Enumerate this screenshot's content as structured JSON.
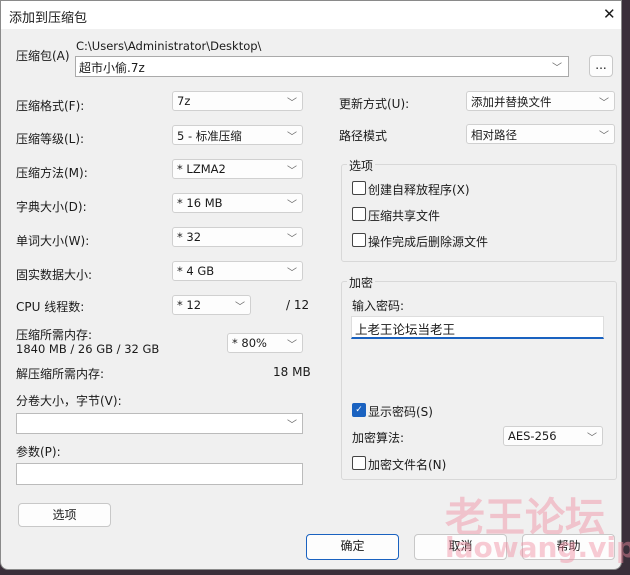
{
  "title": "添加到压缩包",
  "archive": {
    "label": "压缩包(A)",
    "path": "C:\\Users\\Administrator\\Desktop\\",
    "name": "超市小偷.7z",
    "browse": "..."
  },
  "left": [
    {
      "label": "压缩格式(F):",
      "value": "7z"
    },
    {
      "label": "压缩等级(L):",
      "value": "5 - 标准压缩"
    },
    {
      "label": "压缩方法(M):",
      "value": "*  LZMA2"
    },
    {
      "label": "字典大小(D):",
      "value": "*  16 MB"
    },
    {
      "label": "单词大小(W):",
      "value": "*  32"
    },
    {
      "label": "固实数据大小:",
      "value": "*  4 GB"
    }
  ],
  "cpu": {
    "label": "CPU 线程数:",
    "value": "*  12",
    "max": "/ 12"
  },
  "memory": {
    "label": "压缩所需内存:",
    "detail": "1840 MB / 26 GB / 32 GB",
    "value": "* 80%"
  },
  "decomp": {
    "label": "解压缩所需内存:",
    "value": "18 MB"
  },
  "split": {
    "label": "分卷大小，字节(V):",
    "value": ""
  },
  "params": {
    "label": "参数(P):",
    "value": ""
  },
  "options_button": "选项",
  "update": {
    "label": "更新方式(U):",
    "value": "添加并替换文件"
  },
  "pathmode": {
    "label": "路径模式",
    "value": "相对路径"
  },
  "options": {
    "title": "选项",
    "items": [
      {
        "label": "创建自释放程序(X)",
        "checked": false
      },
      {
        "label": "压缩共享文件",
        "checked": false
      },
      {
        "label": "操作完成后删除源文件",
        "checked": false
      }
    ]
  },
  "encryption": {
    "title": "加密",
    "pw_label": "输入密码:",
    "password": "上老王论坛当老王",
    "show": "显示密码(S)",
    "algo_label": "加密算法:",
    "algo": "AES-256",
    "encnames": "加密文件名(N)"
  },
  "buttons": {
    "ok": "确定",
    "cancel": "取消",
    "help": "帮助"
  },
  "watermark": {
    "cn": "老王论坛",
    "url": "laowang.vip"
  }
}
